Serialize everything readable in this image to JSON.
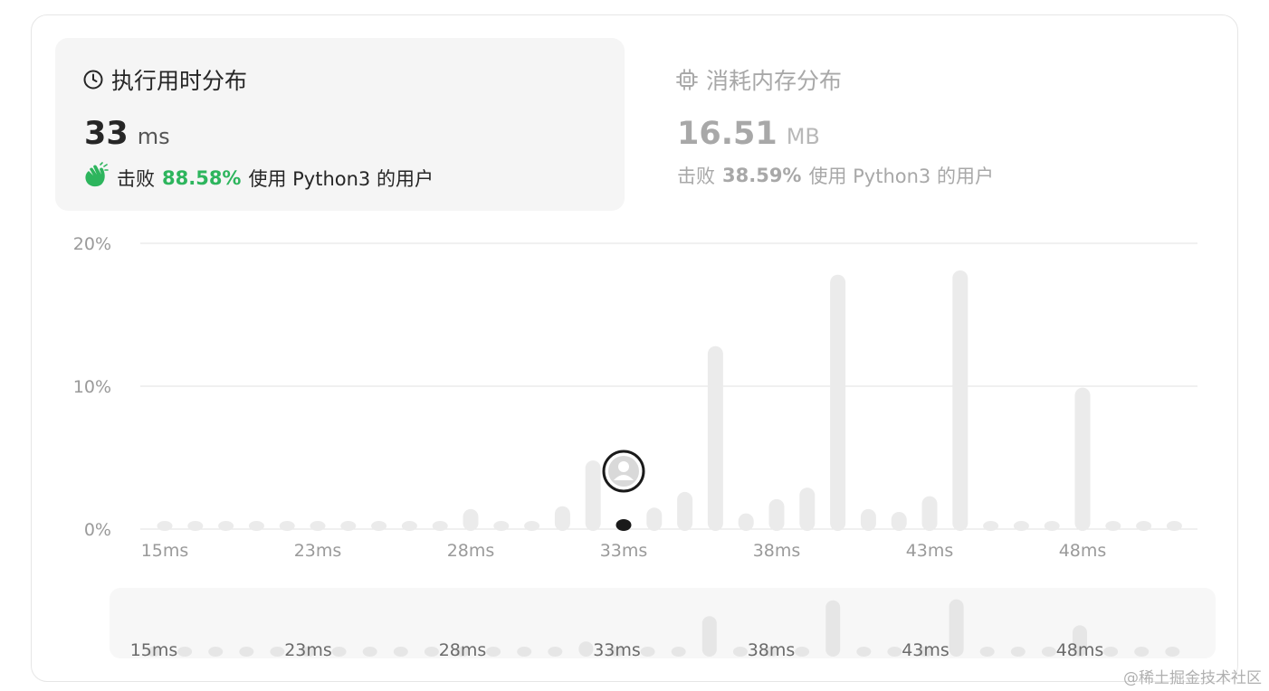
{
  "runtime_tab": {
    "title": "执行用时分布",
    "icon": "clock-icon",
    "value": "33",
    "unit": "ms",
    "beats_prefix": "击败",
    "beats_percent": "88.58%",
    "beats_suffix": "使用 Python3 的用户",
    "accent_color": "#2db55d"
  },
  "memory_tab": {
    "title": "消耗内存分布",
    "icon": "cpu-chip-icon",
    "value": "16.51",
    "unit": "MB",
    "beats_prefix": "击败",
    "beats_percent": "38.59%",
    "beats_suffix": "使用 Python3 的用户"
  },
  "watermark": "@稀土掘金技术社区",
  "chart_data": {
    "type": "bar",
    "title": "",
    "xlabel": "",
    "ylabel": "",
    "ylim": [
      0,
      20
    ],
    "y_ticks": [
      "20%",
      "10%",
      "0%"
    ],
    "y_tick_values": [
      20,
      10,
      0
    ],
    "x_tick_labels": [
      "15ms",
      "23ms",
      "28ms",
      "33ms",
      "38ms",
      "43ms",
      "48ms"
    ],
    "x_tick_bar_index": [
      0,
      5,
      10,
      15,
      20,
      25,
      30
    ],
    "values": [
      0.3,
      0.3,
      0.3,
      0.3,
      0.3,
      0.3,
      0.3,
      0.3,
      0.3,
      0.3,
      1.4,
      0.3,
      0.3,
      1.6,
      4.8,
      0.7,
      1.5,
      2.6,
      12.8,
      1.1,
      2.1,
      2.9,
      17.8,
      1.4,
      1.2,
      2.3,
      18.1,
      0.5,
      0.3,
      0.5,
      9.9,
      0.3,
      0.3,
      0.3
    ],
    "highlight_index": 15,
    "highlight_color": "#1a1a1a",
    "bar_color": "#ebebeb",
    "grid": true,
    "overview_labels": [
      "15ms",
      "23ms",
      "28ms",
      "33ms",
      "38ms",
      "43ms",
      "48ms"
    ]
  }
}
